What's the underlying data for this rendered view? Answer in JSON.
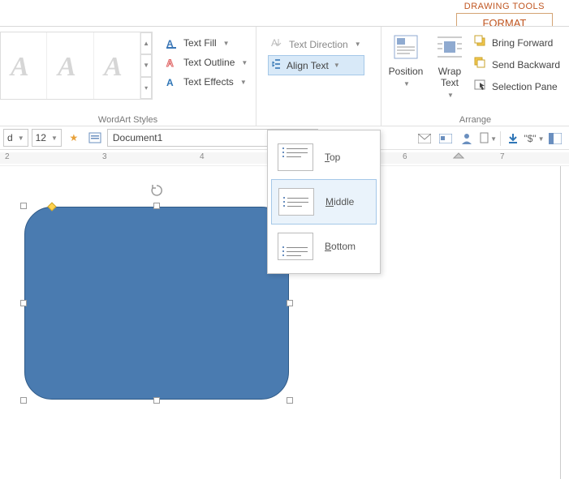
{
  "contextTab": {
    "group": "DRAWING TOOLS",
    "tab": "FORMAT"
  },
  "ribbon": {
    "wordart": {
      "label": "WordArt Styles",
      "textFill": "Text Fill",
      "textOutline": "Text Outline",
      "textEffects": "Text Effects"
    },
    "textgroup": {
      "textDirection": "Text Direction",
      "alignText": "Align Text"
    },
    "arrange": {
      "label": "Arrange",
      "position": "Position",
      "wrapText": "Wrap Text",
      "bringForward": "Bring Forward",
      "sendBackward": "Send Backward",
      "selectionPane": "Selection Pane"
    }
  },
  "alignMenu": {
    "top": "Top",
    "middle": "Middle",
    "bottom": "Bottom"
  },
  "quickbar": {
    "fontSize": "12",
    "docName": "Document1",
    "dollar": "\"$\""
  },
  "ruler": {
    "n2": "2",
    "n3": "3",
    "n4": "4",
    "n6": "6",
    "n7": "7"
  }
}
